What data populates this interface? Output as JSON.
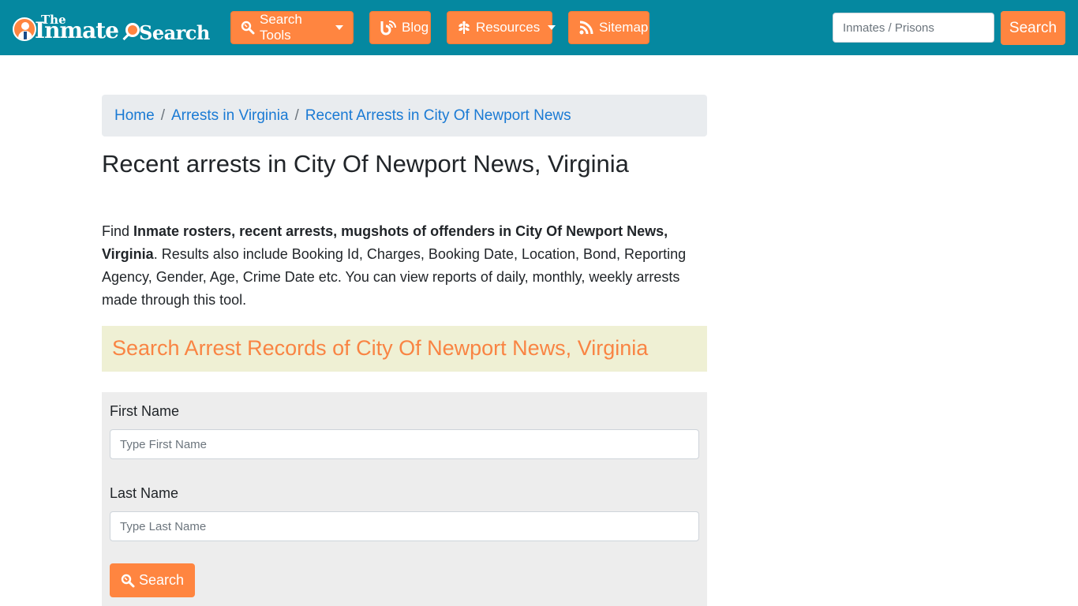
{
  "brand": {
    "name_line1": "The",
    "name_line2": "Inmate",
    "name_line3": "Search",
    "primary_color": "#0588a0",
    "accent_color": "#ff8540"
  },
  "nav": {
    "items": [
      {
        "label": "Search Tools",
        "icon": "search-icon",
        "has_dropdown": true
      },
      {
        "label": "Blog",
        "icon": "blog-icon",
        "has_dropdown": false
      },
      {
        "label": "Resources",
        "icon": "leaf-icon",
        "has_dropdown": true
      },
      {
        "label": "Sitemap",
        "icon": "rss-icon",
        "has_dropdown": false
      }
    ],
    "search": {
      "placeholder": "Inmates / Prisons",
      "value": "",
      "button_label": "Search"
    }
  },
  "breadcrumb": {
    "items": [
      {
        "label": "Home"
      },
      {
        "label": "Arrests in Virginia"
      },
      {
        "label": "Recent Arrests in City Of Newport News"
      }
    ],
    "separator": "/"
  },
  "page": {
    "title": "Recent arrests in City Of Newport News, Virginia",
    "intro": {
      "prefix": "Find ",
      "bold": "Inmate rosters, recent arrests, mugshots of offenders in City Of Newport News, Virginia",
      "suffix": ". Results also include Booking Id, Charges, Booking Date, Location, Bond, Reporting Agency, Gender, Age, Crime Date etc. You can view reports of daily, monthly, weekly arrests made through this tool."
    },
    "section_heading": "Search Arrest Records of City Of Newport News, Virginia"
  },
  "form": {
    "first_name": {
      "label": "First Name",
      "placeholder": "Type First Name",
      "value": ""
    },
    "last_name": {
      "label": "Last Name",
      "placeholder": "Type Last Name",
      "value": ""
    },
    "submit_label": "Search"
  }
}
